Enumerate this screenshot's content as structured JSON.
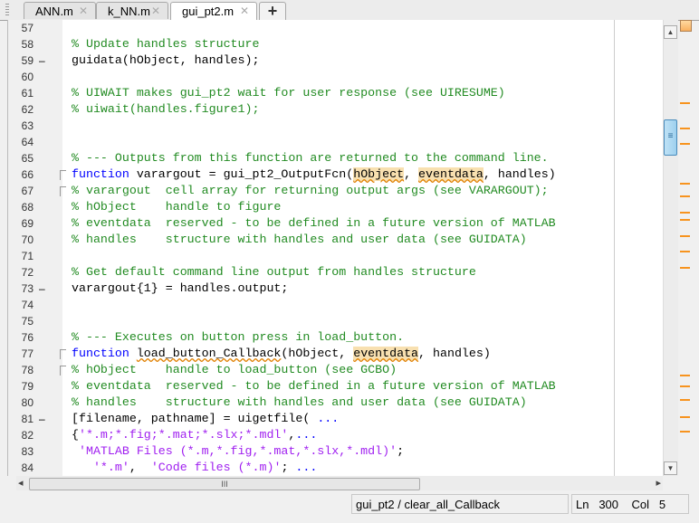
{
  "tabs": [
    {
      "label": "ANN.m",
      "close": "✕",
      "active": false
    },
    {
      "label": "k_NN.m",
      "close": "✕",
      "active": false
    },
    {
      "label": "gui_pt2.m",
      "close": "✕",
      "active": true
    }
  ],
  "new_tab_label": "+",
  "colors": {
    "keyword": "#0000ff",
    "comment": "#228b22",
    "string": "#a020f0",
    "marker": "#f7931e"
  },
  "lines": [
    {
      "n": "57",
      "t": []
    },
    {
      "n": "58",
      "t": [
        {
          "c": "c",
          "v": "% Update handles structure"
        }
      ]
    },
    {
      "n": "59",
      "dash": true,
      "t": [
        {
          "c": "n",
          "v": "guidata(hObject, handles);"
        }
      ]
    },
    {
      "n": "60",
      "t": []
    },
    {
      "n": "61",
      "t": [
        {
          "c": "c",
          "v": "% UIWAIT makes gui_pt2 wait for user response (see UIRESUME)"
        }
      ]
    },
    {
      "n": "62",
      "t": [
        {
          "c": "c",
          "v": "% uiwait(handles.figure1);"
        }
      ]
    },
    {
      "n": "63",
      "t": []
    },
    {
      "n": "64",
      "t": []
    },
    {
      "n": "65",
      "t": [
        {
          "c": "c",
          "v": "% --- Outputs from this function are returned to the command line."
        }
      ]
    },
    {
      "n": "66",
      "fold": true,
      "t": [
        {
          "c": "k",
          "v": "function"
        },
        {
          "c": "n",
          "v": " varargout = gui_pt2_OutputFcn("
        },
        {
          "c": "n hl",
          "v": "hObject"
        },
        {
          "c": "n",
          "v": ", "
        },
        {
          "c": "n hl",
          "v": "eventdata"
        },
        {
          "c": "n",
          "v": ", handles)"
        }
      ]
    },
    {
      "n": "67",
      "fold": true,
      "t": [
        {
          "c": "c",
          "v": "% varargout  cell array for returning output args (see VARARGOUT);"
        }
      ]
    },
    {
      "n": "68",
      "t": [
        {
          "c": "c",
          "v": "% hObject    handle to figure"
        }
      ]
    },
    {
      "n": "69",
      "t": [
        {
          "c": "c",
          "v": "% eventdata  reserved - to be defined in a future version of MATLAB"
        }
      ]
    },
    {
      "n": "70",
      "t": [
        {
          "c": "c",
          "v": "% handles    structure with handles and user data (see GUIDATA)"
        }
      ]
    },
    {
      "n": "71",
      "t": []
    },
    {
      "n": "72",
      "t": [
        {
          "c": "c",
          "v": "% Get default command line output from handles structure"
        }
      ]
    },
    {
      "n": "73",
      "dash": true,
      "t": [
        {
          "c": "n",
          "v": "varargout{1} = handles.output;"
        }
      ]
    },
    {
      "n": "74",
      "t": []
    },
    {
      "n": "75",
      "t": []
    },
    {
      "n": "76",
      "t": [
        {
          "c": "c",
          "v": "% --- Executes on button press in load_button."
        }
      ]
    },
    {
      "n": "77",
      "fold": true,
      "t": [
        {
          "c": "k",
          "v": "function"
        },
        {
          "c": "n",
          "v": " "
        },
        {
          "c": "n wv",
          "v": "load_button_Callback"
        },
        {
          "c": "n",
          "v": "(hObject, "
        },
        {
          "c": "n hl",
          "v": "eventdata"
        },
        {
          "c": "n",
          "v": ", handles)"
        }
      ]
    },
    {
      "n": "78",
      "fold": true,
      "t": [
        {
          "c": "c",
          "v": "% hObject    handle to load_button (see GCBO)"
        }
      ]
    },
    {
      "n": "79",
      "t": [
        {
          "c": "c",
          "v": "% eventdata  reserved - to be defined in a future version of MATLAB"
        }
      ]
    },
    {
      "n": "80",
      "t": [
        {
          "c": "c",
          "v": "% handles    structure with handles and user data (see GUIDATA)"
        }
      ]
    },
    {
      "n": "81",
      "dash": true,
      "t": [
        {
          "c": "n",
          "v": "[filename, pathname] = uigetfile( "
        },
        {
          "c": "k",
          "v": "..."
        }
      ]
    },
    {
      "n": "82",
      "t": [
        {
          "c": "n",
          "v": "{"
        },
        {
          "c": "s",
          "v": "'*.m;*.fig;*.mat;*.slx;*.mdl'"
        },
        {
          "c": "n",
          "v": ","
        },
        {
          "c": "k",
          "v": "..."
        }
      ]
    },
    {
      "n": "83",
      "t": [
        {
          "c": "n",
          "v": " "
        },
        {
          "c": "s",
          "v": "'MATLAB Files (*.m,*.fig,*.mat,*.slx,*.mdl)'"
        },
        {
          "c": "n",
          "v": ";"
        }
      ]
    },
    {
      "n": "84",
      "t": [
        {
          "c": "n",
          "v": "   "
        },
        {
          "c": "s",
          "v": "'*.m'"
        },
        {
          "c": "n",
          "v": ",  "
        },
        {
          "c": "s",
          "v": "'Code files (*.m)'"
        },
        {
          "c": "n",
          "v": "; "
        },
        {
          "c": "k",
          "v": "..."
        }
      ]
    }
  ],
  "status": {
    "function": "gui_pt2 / clear_all_Callback",
    "ln_label": "Ln",
    "ln": "300",
    "col_label": "Col",
    "col": "5"
  },
  "scroll": {
    "thumb_grip": "≡",
    "hthumb_grip": "III",
    "up": "▲",
    "down": "▼",
    "left": "◂",
    "right": "▸"
  }
}
